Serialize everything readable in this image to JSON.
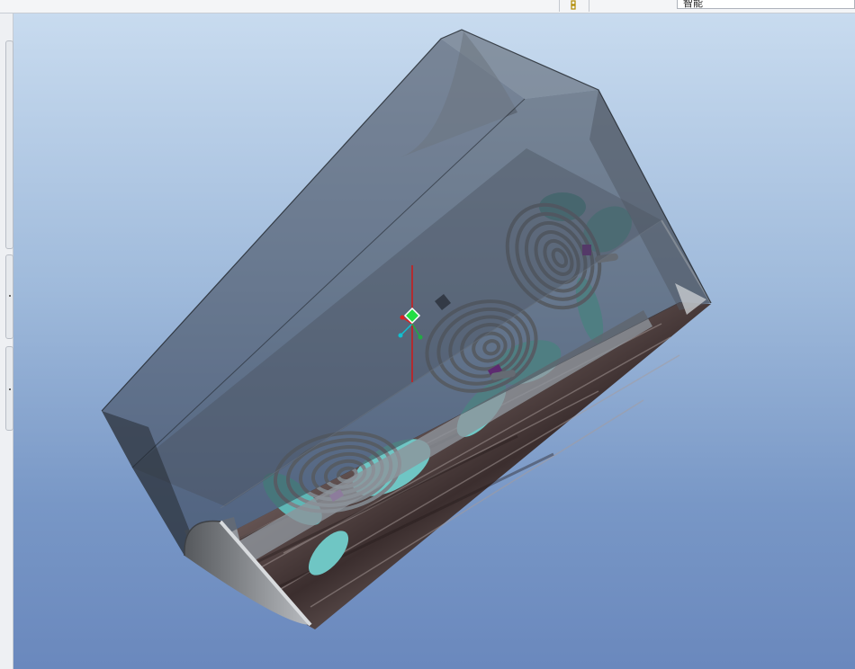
{
  "toolbar": {
    "filter_text": "智能",
    "small_icon": "sash-glyph-icon"
  },
  "viewport": {
    "model": "transparent-housing-with-spiral-fans-assembly",
    "colors": {
      "bg_top": "#c8dbef",
      "bg_bottom": "#6a88bd",
      "housing": "#2f3640",
      "fan_blade": "#6fc6c4",
      "spiral": "#7d8288",
      "axis_red": "#d01818",
      "handle_green": "#22dd44"
    },
    "icons": [
      "spin-center-marker-icon",
      "coordinate-triad-icon"
    ]
  }
}
